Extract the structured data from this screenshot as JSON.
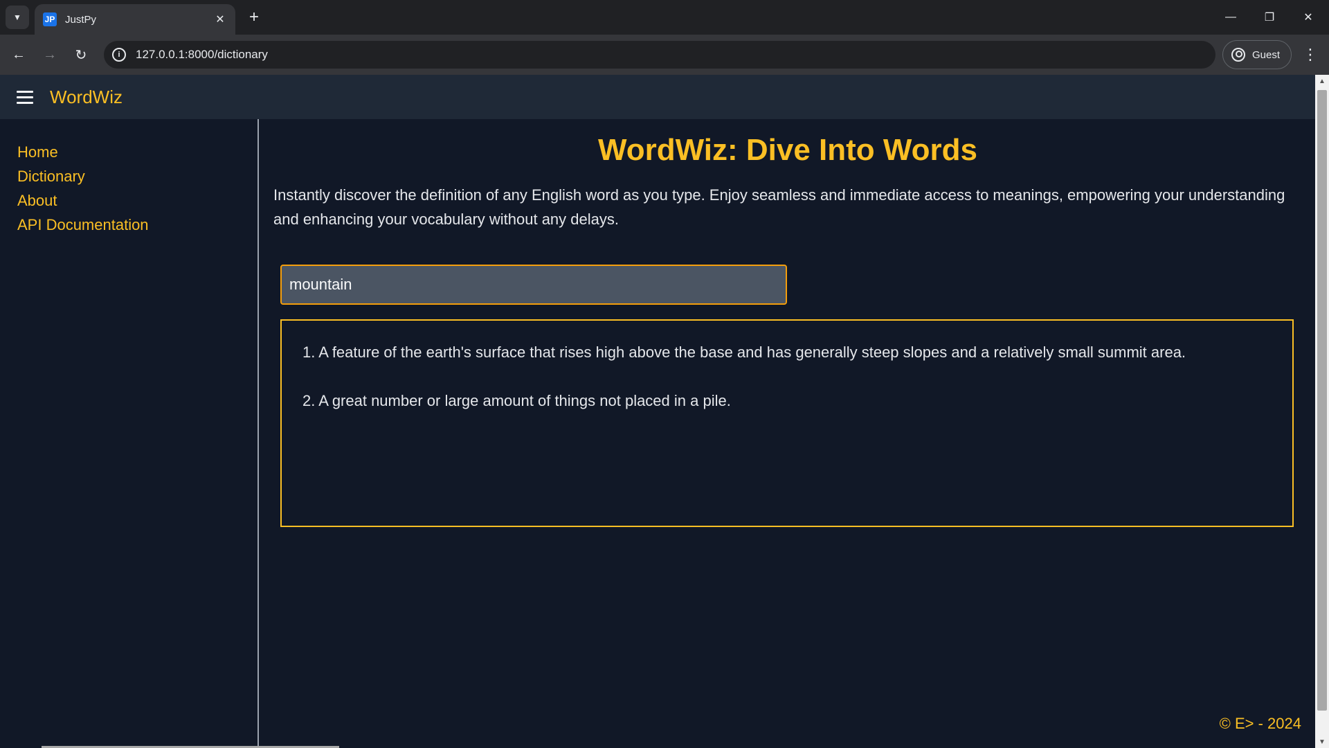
{
  "browser": {
    "tab_title": "JustPy",
    "favicon_text": "JP",
    "url": "127.0.0.1:8000/dictionary",
    "profile_label": "Guest"
  },
  "app": {
    "brand": "WordWiz",
    "nav": [
      {
        "label": "Home"
      },
      {
        "label": "Dictionary"
      },
      {
        "label": "About"
      },
      {
        "label": "API Documentation"
      }
    ],
    "title": "WordWiz: Dive Into Words",
    "description": "Instantly discover the definition of any English word as you type. Enjoy seamless and immediate access to meanings, empowering your understanding and enhancing your vocabulary without any delays.",
    "search_value": "mountain",
    "definitions": [
      "1. A feature of the earth's surface that rises high above the base and has generally steep slopes and a relatively small summit area.",
      "2. A great number or large amount of things not placed in a pile."
    ],
    "footer": "© E> - 2024",
    "accent_color": "#fbbf24"
  }
}
